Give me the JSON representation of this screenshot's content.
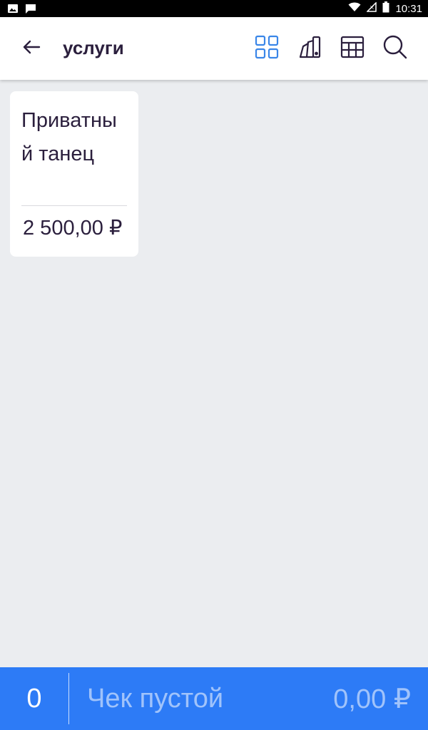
{
  "status_bar": {
    "time": "10:31",
    "icons": [
      "image-notification-icon",
      "message-notification-icon",
      "wifi-icon",
      "no-signal-icon",
      "battery-icon"
    ]
  },
  "header": {
    "title": "услуги",
    "back_icon": "arrow-left-icon",
    "actions": [
      {
        "name": "grid-view-icon",
        "active": true
      },
      {
        "name": "swatch-icon",
        "active": false
      },
      {
        "name": "table-view-icon",
        "active": false
      },
      {
        "name": "search-icon",
        "active": false
      }
    ]
  },
  "items": [
    {
      "name": "Приватный танец",
      "price": "2 500,00 ₽"
    }
  ],
  "cart": {
    "count": "0",
    "status": "Чек пустой",
    "total": "0,00 ₽"
  },
  "colors": {
    "accent": "#2d7bf6",
    "active_icon": "#3a86e8",
    "text": "#2b1f3d",
    "background": "#ebedf0"
  }
}
